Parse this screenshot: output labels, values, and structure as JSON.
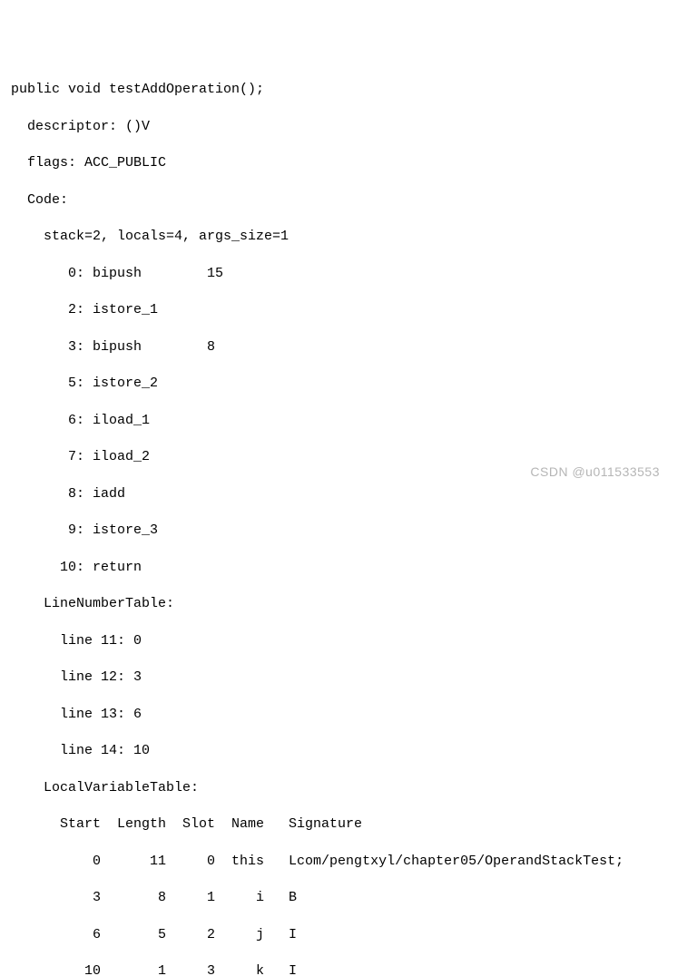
{
  "lines": {
    "l0": "public void testAddOperation();",
    "l1": "  descriptor: ()V",
    "l2": "  flags: ACC_PUBLIC",
    "l3": "  Code:",
    "l4": "    stack=2, locals=4, args_size=1",
    "l5": "       0: bipush        15",
    "l6": "       2: istore_1",
    "l7": "       3: bipush        8",
    "l8": "       5: istore_2",
    "l9": "       6: iload_1",
    "l10": "       7: iload_2",
    "l11": "       8: iadd",
    "l12": "       9: istore_3",
    "l13": "      10: return",
    "l14": "    LineNumberTable:",
    "l15": "      line 11: 0",
    "l16": "      line 12: 3",
    "l17": "      line 13: 6",
    "l18": "      line 14: 10",
    "l19": "    LocalVariableTable:",
    "l20": "      Start  Length  Slot  Name   Signature",
    "l21": "          0      11     0  this   Lcom/pengtxyl/chapter05/OperandStackTest;",
    "l22": "          3       8     1     i   B",
    "l23": "          6       5     2     j   I",
    "l24": "         10       1     3     k   I"
  },
  "watermark": "CSDN @u011533553"
}
